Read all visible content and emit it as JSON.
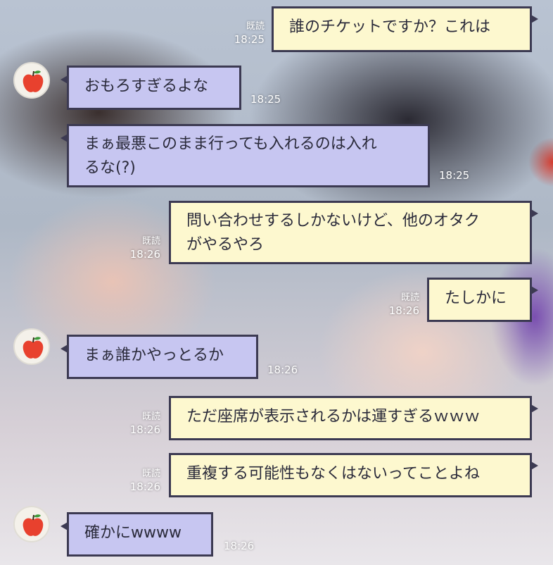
{
  "chat": {
    "messages": [
      {
        "text": "誰のチケットですか？これは",
        "read": "既読",
        "time": "18:25"
      },
      {
        "text": "おもろすぎるよな",
        "time": "18:25"
      },
      {
        "line1": "まぁ最悪このまま行っても入れるのは入れ",
        "line2": "るな(?)",
        "time": "18:25"
      },
      {
        "line1": "問い合わせするしかないけど、他のオタク",
        "line2": "がやるやろ",
        "read": "既読",
        "time": "18:26"
      },
      {
        "text": "たしかに",
        "read": "既読",
        "time": "18:26"
      },
      {
        "text": "まぁ誰かやっとるか",
        "time": "18:26"
      },
      {
        "text": "ただ座席が表示されるかは運すぎるｗｗｗ",
        "read": "既読",
        "time": "18:26"
      },
      {
        "text": "重複する可能性もなくはないってことよね",
        "read": "既読",
        "time": "18:26"
      },
      {
        "text": "確かにwwww",
        "time": "18:26"
      }
    ]
  },
  "colors": {
    "incoming_bubble": "#c7c6f1",
    "outgoing_bubble": "#fdf8cf",
    "bubble_border": "#3c3a52",
    "avatar_apple": "#e8412e"
  },
  "avatar": {
    "icon": "apple-icon"
  }
}
